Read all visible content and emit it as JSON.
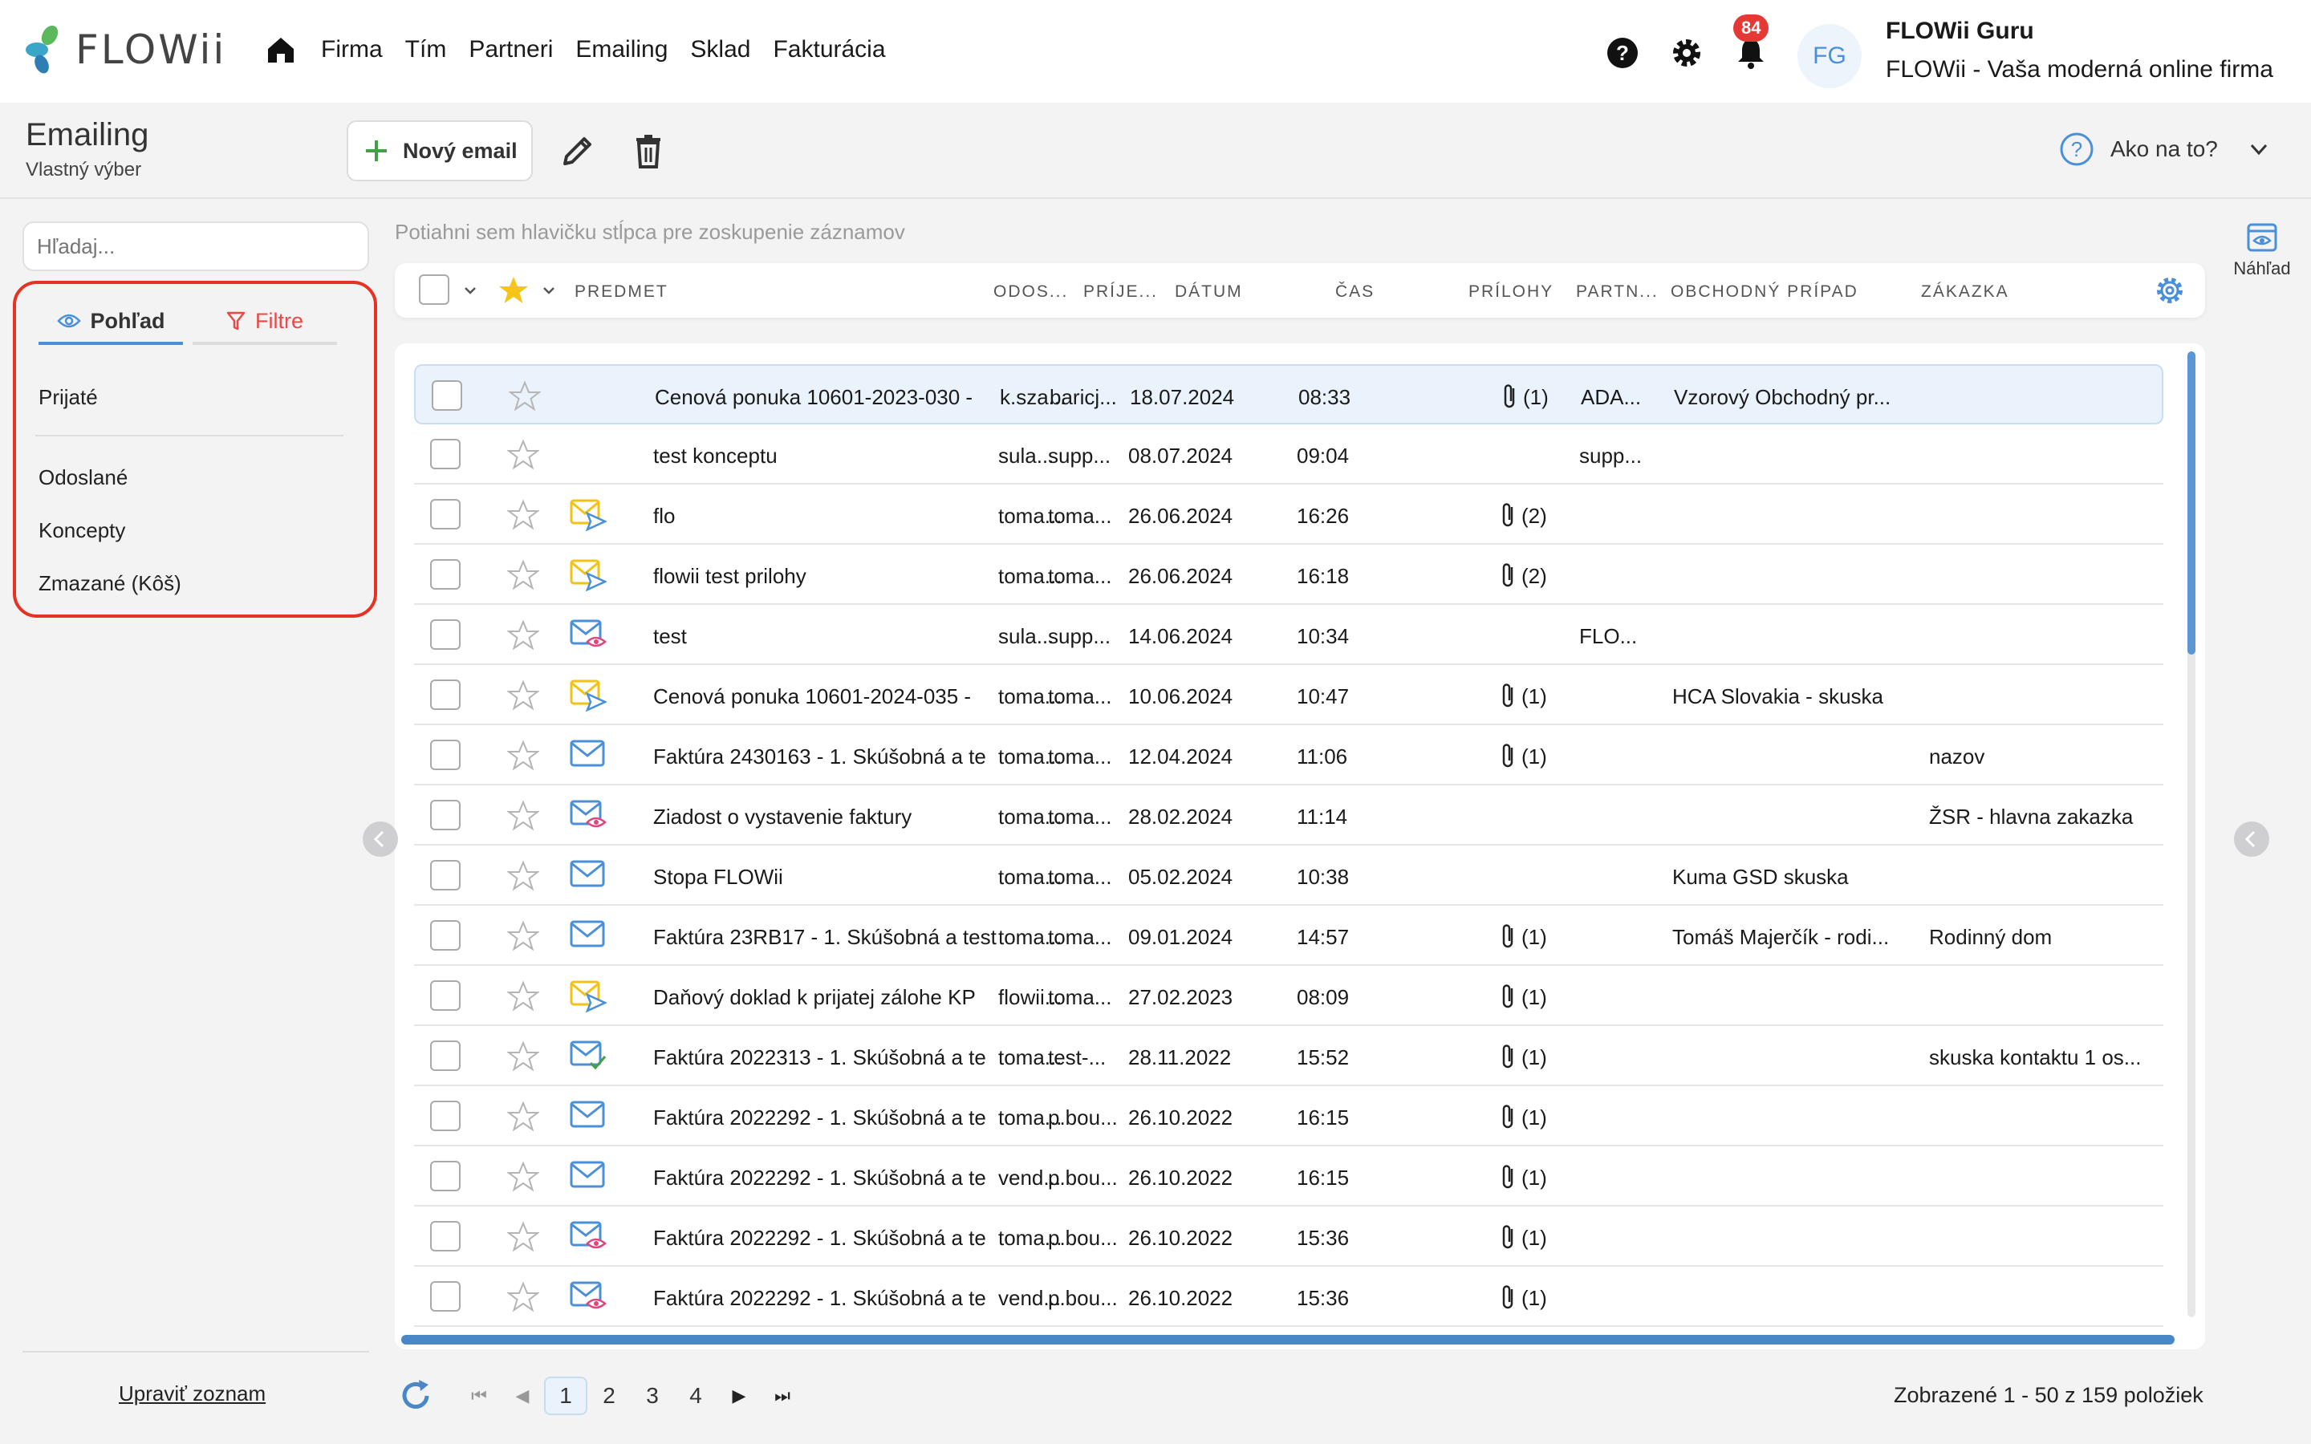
{
  "app": {
    "logo_text": "FLOWii",
    "nav": [
      "Firma",
      "Tím",
      "Partneri",
      "Emailing",
      "Sklad",
      "Fakturácia"
    ],
    "notification_count": "84",
    "user_initials": "FG",
    "user_name": "FLOWii Guru",
    "user_company": "FLOWii - Vaša moderná online firma"
  },
  "header": {
    "title": "Emailing",
    "subtitle": "Vlastný výber",
    "new_email_label": "Nový email",
    "help_label": "Ako na to?"
  },
  "sidebar": {
    "search_placeholder": "Hľadaj...",
    "tab_view": "Pohľad",
    "tab_filter": "Filtre",
    "folders": [
      "Prijaté",
      "Odoslané",
      "Koncepty",
      "Zmazané (Kôš)"
    ],
    "edit_list_label": "Upraviť zoznam"
  },
  "grid": {
    "group_hint": "Potiahni sem hlavičku stĺpca pre zoskupenie záznamov",
    "columns": [
      "PREDMET",
      "ODOS...",
      "PRÍJE...",
      "DÁTUM",
      "ČAS",
      "PRÍLOHY",
      "PARTN...",
      "OBCHODNÝ PRÍPAD",
      "ZÁKAZKA"
    ],
    "rows": [
      {
        "icon": "none",
        "subject": "Cenová ponuka 10601-2023-030 - ",
        "from": "k.sza...",
        "to": "baricj...",
        "date": "18.07.2024",
        "time": "08:33",
        "attachments": "(1)",
        "partner": "ADA...",
        "deal": "Vzorový Obchodný pr...",
        "order": "",
        "selected": true
      },
      {
        "icon": "none",
        "subject": "test konceptu",
        "from": "sula...",
        "to": "supp...",
        "date": "08.07.2024",
        "time": "09:04",
        "attachments": "",
        "partner": "supp...",
        "deal": "",
        "order": ""
      },
      {
        "icon": "sent-mail-icon",
        "subject": "flo",
        "from": "toma...",
        "to": "toma...",
        "date": "26.06.2024",
        "time": "16:26",
        "attachments": "(2)",
        "partner": "",
        "deal": "",
        "order": ""
      },
      {
        "icon": "sent-mail-icon",
        "subject": "flowii test prilohy",
        "from": "toma...",
        "to": "toma...",
        "date": "26.06.2024",
        "time": "16:18",
        "attachments": "(2)",
        "partner": "",
        "deal": "",
        "order": ""
      },
      {
        "icon": "read-mail-icon",
        "subject": "test",
        "from": "sula...",
        "to": "supp...",
        "date": "14.06.2024",
        "time": "10:34",
        "attachments": "",
        "partner": "FLO...",
        "deal": "",
        "order": ""
      },
      {
        "icon": "sent-mail-icon",
        "subject": "Cenová ponuka 10601-2024-035 - ",
        "from": "toma...",
        "to": "toma...",
        "date": "10.06.2024",
        "time": "10:47",
        "attachments": "(1)",
        "partner": "",
        "deal": "HCA Slovakia - skuska",
        "order": ""
      },
      {
        "icon": "mail-icon",
        "subject": "Faktúra 2430163 - 1. Skúšobná a te",
        "from": "toma...",
        "to": "toma...",
        "date": "12.04.2024",
        "time": "11:06",
        "attachments": "(1)",
        "partner": "",
        "deal": "",
        "order": "nazov"
      },
      {
        "icon": "read-mail-icon",
        "subject": "Ziadost o vystavenie faktury",
        "from": "toma...",
        "to": "toma...",
        "date": "28.02.2024",
        "time": "11:14",
        "attachments": "",
        "partner": "",
        "deal": "",
        "order": "ŽSR - hlavna zakazka"
      },
      {
        "icon": "mail-icon",
        "subject": "Stopa FLOWii",
        "from": "toma...",
        "to": "toma...",
        "date": "05.02.2024",
        "time": "10:38",
        "attachments": "",
        "partner": "",
        "deal": "Kuma GSD skuska",
        "order": ""
      },
      {
        "icon": "mail-icon",
        "subject": "Faktúra 23RB17 - 1. Skúšobná a test",
        "from": "toma...",
        "to": "toma...",
        "date": "09.01.2024",
        "time": "14:57",
        "attachments": "(1)",
        "partner": "",
        "deal": "Tomáš Majerčík - rodi...",
        "order": "Rodinný dom"
      },
      {
        "icon": "sent-mail-icon",
        "subject": "Daňový doklad k prijatej zálohe KP",
        "from": "flowii...",
        "to": "toma...",
        "date": "27.02.2023",
        "time": "08:09",
        "attachments": "(1)",
        "partner": "",
        "deal": "",
        "order": ""
      },
      {
        "icon": "delivered-mail-icon",
        "subject": "Faktúra 2022313 - 1. Skúšobná a te",
        "from": "toma...",
        "to": "test-...",
        "date": "28.11.2022",
        "time": "15:52",
        "attachments": "(1)",
        "partner": "",
        "deal": "",
        "order": "skuska kontaktu 1 os..."
      },
      {
        "icon": "mail-icon",
        "subject": "Faktúra 2022292 - 1. Skúšobná a te",
        "from": "toma...",
        "to": "p.bou...",
        "date": "26.10.2022",
        "time": "16:15",
        "attachments": "(1)",
        "partner": "",
        "deal": "",
        "order": ""
      },
      {
        "icon": "mail-icon",
        "subject": "Faktúra 2022292 - 1. Skúšobná a te",
        "from": "vend...",
        "to": "p.bou...",
        "date": "26.10.2022",
        "time": "16:15",
        "attachments": "(1)",
        "partner": "",
        "deal": "",
        "order": ""
      },
      {
        "icon": "read-mail-icon",
        "subject": "Faktúra 2022292 - 1. Skúšobná a te",
        "from": "toma...",
        "to": "p.bou...",
        "date": "26.10.2022",
        "time": "15:36",
        "attachments": "(1)",
        "partner": "",
        "deal": "",
        "order": ""
      },
      {
        "icon": "read-mail-icon",
        "subject": "Faktúra 2022292 - 1. Skúšobná a te",
        "from": "vend...",
        "to": "p.bou...",
        "date": "26.10.2022",
        "time": "15:36",
        "attachments": "(1)",
        "partner": "",
        "deal": "",
        "order": ""
      }
    ]
  },
  "preview_label": "Náhľad",
  "pagination": {
    "pages": [
      "1",
      "2",
      "3",
      "4"
    ],
    "current": "1",
    "info": "Zobrazené 1 - 50 z 159 položiek"
  },
  "colors": {
    "accent_blue": "#4a90d9",
    "highlight_red": "#e53222",
    "badge_red": "#e53935",
    "sent_yellow": "#f2c314"
  }
}
